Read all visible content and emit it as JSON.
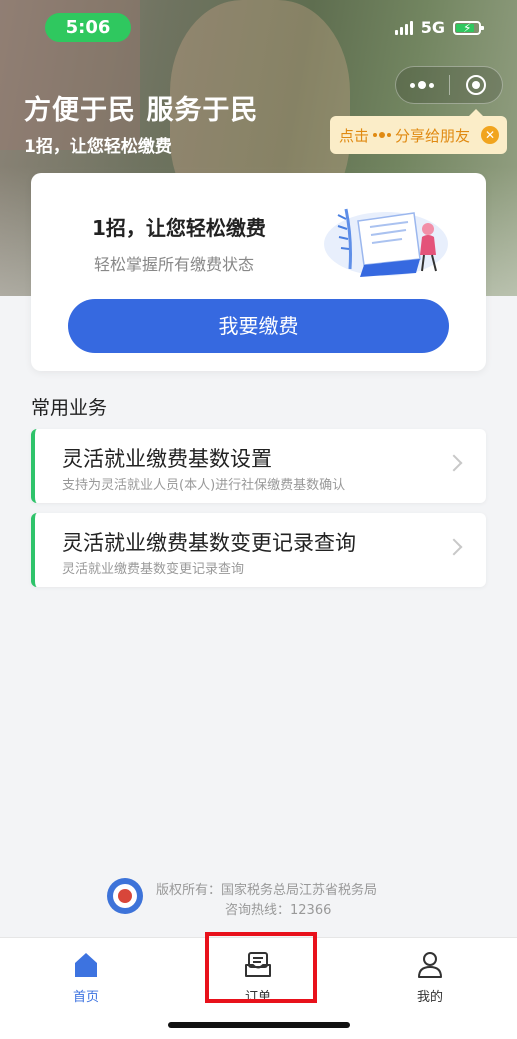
{
  "status_bar": {
    "time": "5:06",
    "network": "5G"
  },
  "colors": {
    "primary": "#3669e0",
    "accent_green": "#2ec36a",
    "tip_orange": "#e08a12",
    "highlight_red": "#e8111b"
  },
  "hero": {
    "title": "方便于民 服务于民",
    "subtitle": "1招，让您轻松缴费"
  },
  "capsule": {
    "more_icon": "more-dots-icon",
    "close_icon": "target-circle-icon"
  },
  "share_tip": {
    "prefix": "点击",
    "suffix": "分享给朋友",
    "close_icon": "close-icon"
  },
  "card": {
    "title": "1招，让您轻松缴费",
    "subtitle": "轻松掌握所有缴费状态",
    "button": "我要缴费",
    "illustration": "paying-person-illustration"
  },
  "section": {
    "title": "常用业务"
  },
  "services": [
    {
      "title": "灵活就业缴费基数设置",
      "desc": "支持为灵活就业人员(本人)进行社保缴费基数确认"
    },
    {
      "title": "灵活就业缴费基数变更记录查询",
      "desc": "灵活就业缴费基数变更记录查询"
    }
  ],
  "footer": {
    "copyright": "版权所有：国家税务总局江苏省税务局",
    "hotline": "咨询热线：12366",
    "logo": "tax-bureau-emblem"
  },
  "tabbar": {
    "tabs": [
      {
        "label": "首页",
        "icon": "home-icon",
        "active": true
      },
      {
        "label": "订单",
        "icon": "order-icon",
        "active": false
      },
      {
        "label": "我的",
        "icon": "user-icon",
        "active": false
      }
    ]
  }
}
